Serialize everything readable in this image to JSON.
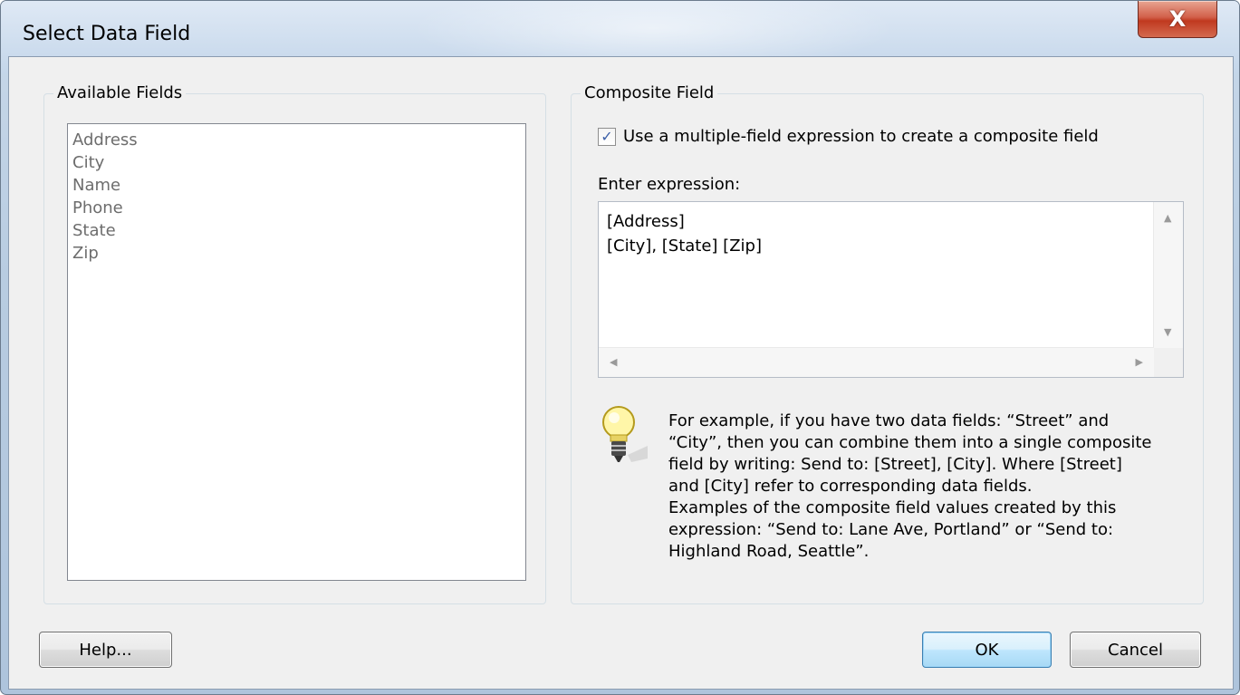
{
  "window": {
    "title": "Select Data Field",
    "close_glyph": "X"
  },
  "available": {
    "title": "Available Fields",
    "fields": [
      "Address",
      "City",
      "Name",
      "Phone",
      "State",
      "Zip"
    ]
  },
  "composite": {
    "title": "Composite Field",
    "checkbox_label": "Use a multiple-field expression to create a composite field",
    "checkbox_checked": true,
    "expression_label": "Enter expression:",
    "expression_value": "[Address]\n[City], [State] [Zip]",
    "info_lines": [
      "For example, if you have two data fields: “Street” and",
      "“City”, then you can combine them into a single composite",
      "field by writing: Send to: [Street], [City]. Where [Street]",
      "and [City] refer to corresponding data fields.",
      "Examples of the composite field values created by this",
      "expression: “Send to: Lane Ave, Portland” or “Send to:",
      "Highland Road, Seattle”."
    ],
    "info_icon": "lightbulb-icon"
  },
  "buttons": {
    "help": "Help...",
    "ok": "OK",
    "cancel": "Cancel"
  }
}
